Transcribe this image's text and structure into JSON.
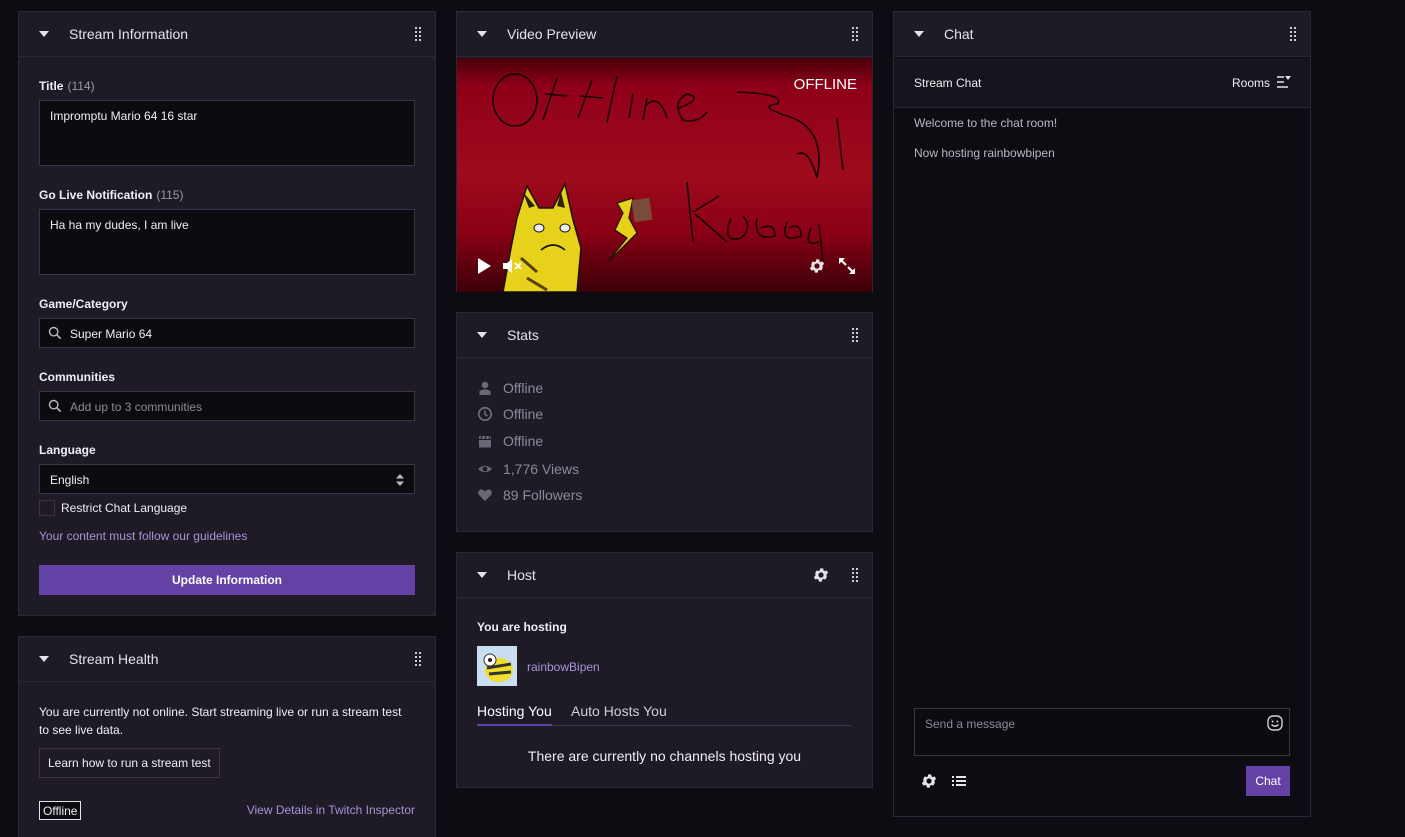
{
  "stream_info": {
    "panel_title": "Stream Information",
    "title_label": "Title",
    "title_count": "(114)",
    "title_value": "Impromptu Mario 64 16 star",
    "notif_label": "Go Live Notification",
    "notif_count": "(115)",
    "notif_value": "Ha ha my dudes, I am live",
    "game_label": "Game/Category",
    "game_value": "Super Mario 64",
    "communities_label": "Communities",
    "communities_placeholder": "Add up to 3 communities",
    "language_label": "Language",
    "language_value": "English",
    "restrict_label": "Restrict Chat Language",
    "guidelines_text": "Your content must follow our guidelines",
    "update_button": "Update Information"
  },
  "stream_health": {
    "panel_title": "Stream Health",
    "message": "You are currently not online. Start streaming live or run a stream test to see live data.",
    "learn_button": "Learn how to run a stream test",
    "status_badge": "Offline",
    "inspector_link": "View Details in Twitch Inspector"
  },
  "video_preview": {
    "panel_title": "Video Preview",
    "offline_label": "OFFLINE",
    "scribble_text_1": "Offline",
    "scribble_text_2": "Koeeq"
  },
  "stats": {
    "panel_title": "Stats",
    "viewers": "Offline",
    "uptime": "Offline",
    "clips": "Offline",
    "views": "1,776 Views",
    "followers": "89 Followers"
  },
  "host": {
    "panel_title": "Host",
    "hosting_label": "You are hosting",
    "hosted_channel": "rainbowBipen",
    "tab_hosting_you": "Hosting You",
    "tab_auto_hosts": "Auto Hosts You",
    "empty_message": "There are currently no channels hosting you"
  },
  "chat": {
    "panel_title": "Chat",
    "header_label": "Stream Chat",
    "rooms_label": "Rooms",
    "messages": [
      "Welcome to the chat room!",
      "Now hosting rainbowbipen"
    ],
    "input_placeholder": "Send a message",
    "send_button": "Chat"
  },
  "colors": {
    "accent": "#6441a4",
    "link": "#a695d8",
    "panel_bg": "#1f1b26",
    "page_bg": "#0e0c13"
  }
}
